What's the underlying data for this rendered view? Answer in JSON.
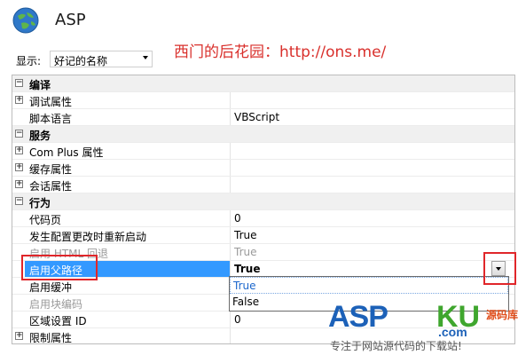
{
  "header": {
    "title": "ASP",
    "watermark": "西门的后花园：http://ons.me/"
  },
  "toolbar": {
    "show_label": "显示:",
    "sort_value": "好记的名称"
  },
  "grid": {
    "rows": [
      {
        "type": "category",
        "name": "编译",
        "expander": "⊟"
      },
      {
        "type": "group",
        "name": "调试属性",
        "value": "",
        "expander": "+"
      },
      {
        "type": "prop",
        "name": "脚本语言",
        "value": "VBScript"
      },
      {
        "type": "category",
        "name": "服务",
        "expander": "⊟"
      },
      {
        "type": "group",
        "name": "Com Plus 属性",
        "value": "",
        "expander": "+"
      },
      {
        "type": "group",
        "name": "缓存属性",
        "value": "",
        "expander": "+"
      },
      {
        "type": "group",
        "name": "会话属性",
        "value": "",
        "expander": "+"
      },
      {
        "type": "category",
        "name": "行为",
        "expander": "⊟"
      },
      {
        "type": "prop",
        "name": "代码页",
        "value": "0"
      },
      {
        "type": "prop",
        "name": "发生配置更改时重新启动",
        "value": "True"
      },
      {
        "type": "disabled",
        "name": "启用 HTML 回退",
        "value": "True"
      },
      {
        "type": "selected",
        "name": "启用父路径",
        "value": "True"
      },
      {
        "type": "prop",
        "name": "启用缓冲",
        "value": ""
      },
      {
        "type": "disabled",
        "name": "启用块编码",
        "value": ""
      },
      {
        "type": "prop",
        "name": "区域设置 ID",
        "value": "0"
      },
      {
        "type": "group",
        "name": "限制属性",
        "value": "",
        "expander": "+"
      }
    ]
  },
  "dropdown": {
    "options": [
      "True",
      "False"
    ],
    "selected": "True"
  },
  "footer": {
    "asp": "ASP",
    "ku": "KU",
    "cn": "源码库",
    "com": ".com",
    "slogan": "专注于网站源代码的下载站!"
  }
}
